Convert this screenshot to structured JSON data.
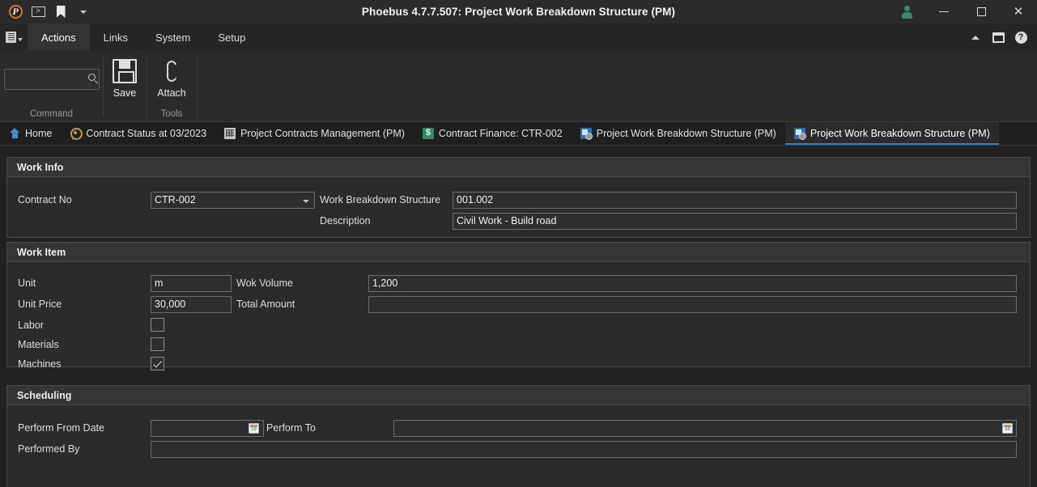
{
  "titlebar": {
    "title": "Phoebus 4.7.7.507: Project Work Breakdown Structure (PM)",
    "logo_glyph": "P",
    "console_glyph": ">",
    "minimize_label": "",
    "maximize_label": "",
    "close_label": "✕"
  },
  "menubar": {
    "items": [
      {
        "label": "Actions",
        "active": true
      },
      {
        "label": "Links",
        "active": false
      },
      {
        "label": "System",
        "active": false
      },
      {
        "label": "Setup",
        "active": false
      }
    ],
    "help_glyph": "?"
  },
  "ribbon": {
    "search_value": "",
    "search_placeholder": "",
    "groups": [
      {
        "caption": "Command"
      },
      {
        "caption": "Tools"
      }
    ],
    "buttons": [
      {
        "label": "Save",
        "icon": "save-icon"
      },
      {
        "label": "Attach",
        "icon": "paperclip-icon"
      }
    ]
  },
  "tabs": [
    {
      "label": "Home",
      "icon": "home-icon",
      "active": false
    },
    {
      "label": "Contract Status at 03/2023",
      "icon": "target-icon",
      "active": false
    },
    {
      "label": "Project Contracts Management (PM)",
      "icon": "building-icon",
      "active": false
    },
    {
      "label": "Contract Finance: CTR-002",
      "icon": "money-icon",
      "active": false
    },
    {
      "label": "Project Work Breakdown Structure (PM)",
      "icon": "form-icon",
      "active": false
    },
    {
      "label": "Project Work Breakdown Structure (PM)",
      "icon": "form-icon",
      "active": true
    }
  ],
  "work_info": {
    "title": "Work Info",
    "contract_no_label": "Contract No",
    "contract_no_value": "CTR-002",
    "wbs_label": "Work Breakdown Structure",
    "wbs_value": "001.002",
    "description_label": "Description",
    "description_value": "Civil Work - Build road"
  },
  "work_item": {
    "title": "Work Item",
    "unit_label": "Unit",
    "unit_value": "m",
    "wok_volume_label": "Wok Volume",
    "wok_volume_value": "1,200",
    "unit_price_label": "Unit Price",
    "unit_price_value": "30,000",
    "total_amount_label": "Total Amount",
    "total_amount_value": "",
    "labor_label": "Labor",
    "labor_checked": false,
    "materials_label": "Materials",
    "materials_checked": false,
    "machines_label": "Machines",
    "machines_checked": true
  },
  "scheduling": {
    "title": "Scheduling",
    "perform_from_label": "Perform From Date",
    "perform_from_value": "",
    "perform_to_label": "Perform To",
    "perform_to_value": "",
    "performed_by_label": "Performed By",
    "performed_by_value": ""
  },
  "colors": {
    "accent": "#2d7fd3",
    "window_bg": "#222222",
    "panel_bg": "#2b2b2b",
    "panel_header_bg": "#353535",
    "border": "#4a4a4a",
    "field_border": "#6d6d6d",
    "logo_orange": "#d96f23",
    "user_green": "#3d8a6b"
  }
}
